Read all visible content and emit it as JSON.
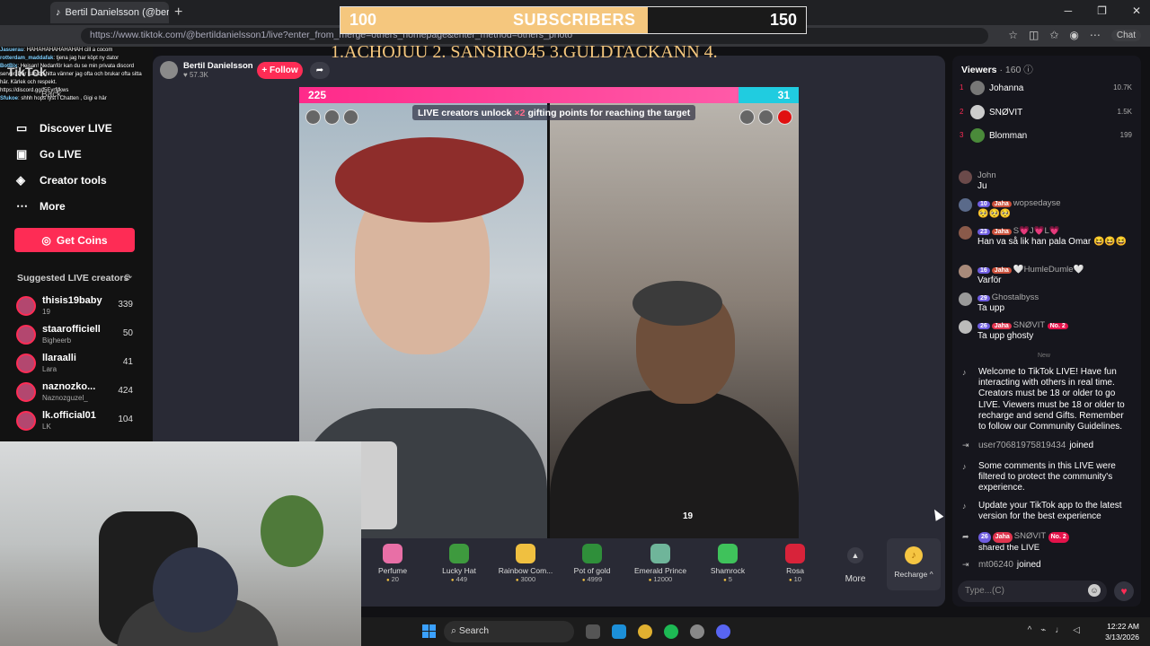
{
  "browser": {
    "tab_title": "Bertil Danielsson (@bertil",
    "url": "https://www.tiktok.com/@bertildanielsson1/live?enter_from_merge=others_homepage&enter_method=others_photo",
    "chat_button": "Chat"
  },
  "subscribers_overlay": {
    "current": "100",
    "title": "SUBSCRIBERS",
    "goal": "150",
    "progress_fraction": 0.66
  },
  "top_gifters_text": "1.ACHOJUU  2. SANSIRO45  3.GULDTACKANN  4.",
  "stream_chat_overlay": [
    {
      "user": "Jasuerau",
      "text": "HAHAHAHAHAHAHAH cill a cocom"
    },
    {
      "user": "rotterdam_maddafak",
      "text": "tjena jag har köpt ny dator"
    },
    {
      "user": "BotBix",
      "text": "Hejsan! Nedanför kan du se min privata discord server. Där kan du hitta vänner jag ofta och brukar ofta sitta här. Kärlek och respekt."
    },
    {
      "user": "",
      "text": "https://discord.gg/f5Eyrfjfkws"
    },
    {
      "user": "Sfukoe",
      "text": "shhh hops tyst i Chatten , Gigi e här"
    }
  ],
  "left_sidebar": {
    "brand": "TikTok",
    "back_label": "Back",
    "nav": [
      {
        "label": "Discover LIVE",
        "icon": "tv-icon"
      },
      {
        "label": "Go LIVE",
        "icon": "camera-icon"
      },
      {
        "label": "Creator tools",
        "icon": "lightbulb-icon"
      },
      {
        "label": "More",
        "icon": "dots-icon"
      }
    ],
    "get_coins": "Get Coins",
    "suggested_title": "Suggested LIVE creators",
    "suggested": [
      {
        "name": "thisis19baby",
        "sub": "19",
        "count": "339"
      },
      {
        "name": "staarofficiell",
        "sub": "Bigheerb",
        "count": "50"
      },
      {
        "name": "llaraalli",
        "sub": "Lara",
        "count": "41"
      },
      {
        "name": "naznozko...",
        "sub": "Naznozguzel_",
        "count": "424"
      },
      {
        "name": "lk.official01",
        "sub": "LK",
        "count": "104"
      }
    ]
  },
  "host": {
    "name": "Bertil Danielsson",
    "likes": "57.3K",
    "follow_label": "+ Follow"
  },
  "battle": {
    "left_score": "225",
    "right_score": "31",
    "notice_pre": "LIVE creators unlock",
    "notice_mult": "×2",
    "notice_post": "gifting points for reaching the target",
    "right_pane_score": "19"
  },
  "gifts": [
    {
      "name": "Perfume",
      "price": "20",
      "color": "#e86fa6"
    },
    {
      "name": "Lucky Hat",
      "price": "449",
      "color": "#3e9a3e"
    },
    {
      "name": "Rainbow Com...",
      "price": "3000",
      "color": "#f0c040"
    },
    {
      "name": "Pot of gold",
      "price": "4999",
      "color": "#2f8f3a"
    },
    {
      "name": "Emerald Prince",
      "price": "12000",
      "color": "#6fb59a"
    },
    {
      "name": "Shamrock",
      "price": "5",
      "color": "#3fc25b"
    },
    {
      "name": "Rosa",
      "price": "10",
      "color": "#d8233a"
    }
  ],
  "gift_more": "More",
  "recharge_label": "Recharge ^",
  "viewers": {
    "title": "Viewers",
    "count": "· 160",
    "top": [
      {
        "rank": "1",
        "name": "Johanna",
        "score": "10.7K"
      },
      {
        "rank": "2",
        "name": "SNØVIT",
        "score": "1.5K"
      },
      {
        "rank": "3",
        "name": "Blomman",
        "score": "199"
      }
    ]
  },
  "comments": [
    {
      "user": "John",
      "badges": [],
      "text": "Ju"
    },
    {
      "user": "wopsedayse",
      "badges": [
        "10",
        "Jaha"
      ],
      "text": "🥺🥺🥺"
    },
    {
      "user": "S💗J💗L💗",
      "badges": [
        "23",
        "Jaha"
      ],
      "text": "Han va så lik han pala Omar 😆😆😆"
    },
    {
      "user": "🤍HumleDumle🤍",
      "badges": [
        "16",
        "Jaha"
      ],
      "text": "Varför"
    },
    {
      "user": "Ghostalbyss",
      "badges": [
        "29"
      ],
      "text": "Ta upp"
    },
    {
      "user": "SNØVIT",
      "badges": [
        "26",
        "Jaha",
        "No. 2"
      ],
      "text": "Ta upp ghosty"
    }
  ],
  "new_separator": "New",
  "system_messages": {
    "welcome": "Welcome to TikTok LIVE! Have fun interacting with others in real time. Creators must be 18 or older to go LIVE. Viewers must be 18 or older to recharge and send Gifts. Remember to follow our Community Guidelines.",
    "joined1_user": "user70681975819434",
    "joined_label": "joined",
    "filtered": "Some comments in this LIVE were filtered to protect the community's experience.",
    "update": "Update your TikTok app to the latest version for the best experience",
    "share_user": "SNØVIT",
    "share_badges": [
      "26",
      "Jaha",
      "No. 2"
    ],
    "share_text": "shared the LIVE",
    "joined2_user": "mt06240"
  },
  "chat_input_placeholder": "Type...(C)",
  "taskbar": {
    "search": "Search",
    "time": "12:22 AM",
    "date": "3/13/2026"
  }
}
